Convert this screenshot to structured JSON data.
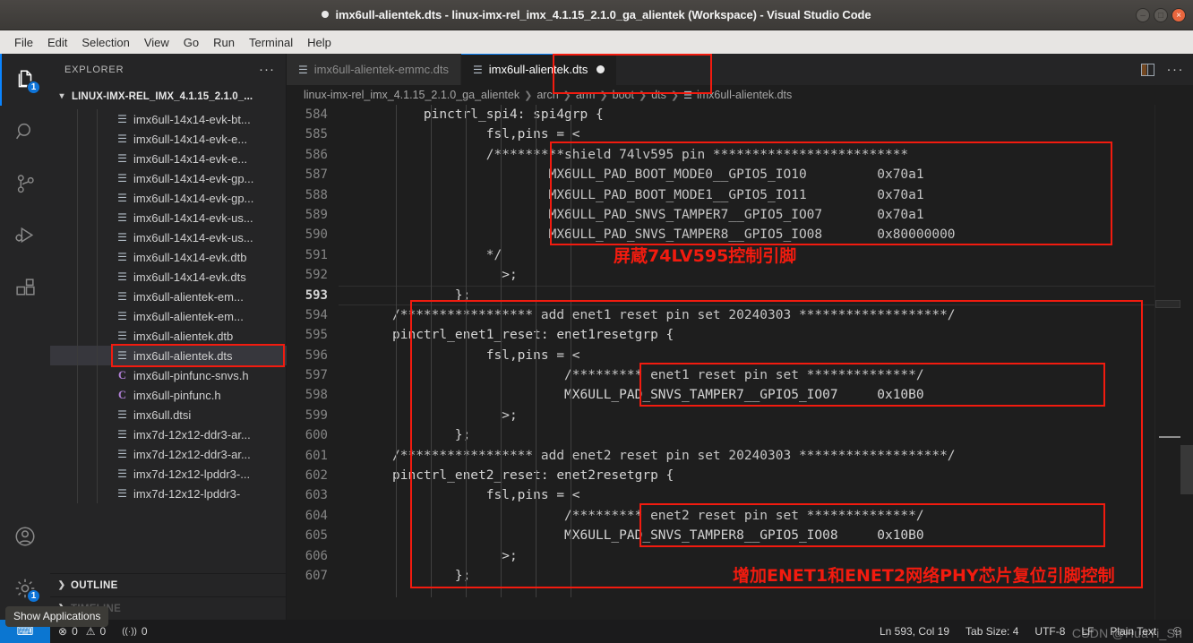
{
  "window": {
    "title": "imx6ull-alientek.dts - linux-imx-rel_imx_4.1.15_2.1.0_ga_alientek (Workspace) - Visual Studio Code",
    "dirty": true,
    "buttons": {
      "minimize": "–",
      "maximize": "□",
      "close": "×"
    }
  },
  "menubar": {
    "items": [
      "File",
      "Edit",
      "Selection",
      "View",
      "Go",
      "Run",
      "Terminal",
      "Help"
    ]
  },
  "activitybar": {
    "items": [
      {
        "name": "explorer-icon",
        "badge": "1",
        "active": true
      },
      {
        "name": "search-icon",
        "badge": "",
        "active": false
      },
      {
        "name": "source-control-icon",
        "badge": "",
        "active": false
      },
      {
        "name": "run-and-debug-icon",
        "badge": "",
        "active": false
      },
      {
        "name": "extensions-icon",
        "badge": "",
        "active": false
      }
    ],
    "bottom": [
      {
        "name": "accounts-icon",
        "badge": ""
      },
      {
        "name": "manage-gear-icon",
        "badge": "1"
      }
    ]
  },
  "sidebar": {
    "title": "EXPLORER",
    "more_actions": "···",
    "root_label": "LINUX-IMX-REL_IMX_4.1.15_2.1.0_...",
    "files": [
      {
        "label": "imx6ull-14x14-evk-bt...",
        "kind": "dts",
        "selected": false
      },
      {
        "label": "imx6ull-14x14-evk-e...",
        "kind": "dts",
        "selected": false
      },
      {
        "label": "imx6ull-14x14-evk-e...",
        "kind": "dts",
        "selected": false
      },
      {
        "label": "imx6ull-14x14-evk-gp...",
        "kind": "dts",
        "selected": false
      },
      {
        "label": "imx6ull-14x14-evk-gp...",
        "kind": "dts",
        "selected": false
      },
      {
        "label": "imx6ull-14x14-evk-us...",
        "kind": "dts",
        "selected": false
      },
      {
        "label": "imx6ull-14x14-evk-us...",
        "kind": "dts",
        "selected": false
      },
      {
        "label": "imx6ull-14x14-evk.dtb",
        "kind": "dts",
        "selected": false
      },
      {
        "label": "imx6ull-14x14-evk.dts",
        "kind": "dts",
        "selected": false
      },
      {
        "label": "imx6ull-alientek-em...",
        "kind": "dts",
        "selected": false
      },
      {
        "label": "imx6ull-alientek-em...",
        "kind": "dts",
        "selected": false
      },
      {
        "label": "imx6ull-alientek.dtb",
        "kind": "dts",
        "selected": false
      },
      {
        "label": "imx6ull-alientek.dts",
        "kind": "dts",
        "selected": true
      },
      {
        "label": "imx6ull-pinfunc-snvs.h",
        "kind": "c",
        "selected": false
      },
      {
        "label": "imx6ull-pinfunc.h",
        "kind": "c",
        "selected": false
      },
      {
        "label": "imx6ull.dtsi",
        "kind": "dts",
        "selected": false
      },
      {
        "label": "imx7d-12x12-ddr3-ar...",
        "kind": "dts",
        "selected": false
      },
      {
        "label": "imx7d-12x12-ddr3-ar...",
        "kind": "dts",
        "selected": false
      },
      {
        "label": "imx7d-12x12-lpddr3-...",
        "kind": "dts",
        "selected": false
      },
      {
        "label": "imx7d-12x12-lpddr3-",
        "kind": "dts",
        "selected": false
      }
    ],
    "sections": [
      {
        "label": "OUTLINE",
        "dim": false
      },
      {
        "label": "TIMELINE",
        "dim": true
      }
    ]
  },
  "tooltip": {
    "show_applications": "Show Applications"
  },
  "tabs": [
    {
      "label": "imx6ull-alientek-emmc.dts",
      "active": false,
      "dirty": false,
      "highlighted": false
    },
    {
      "label": "imx6ull-alientek.dts",
      "active": true,
      "dirty": true,
      "highlighted": true
    }
  ],
  "tabbar_actions": {
    "split_editor": "split-editor-icon",
    "more": "···"
  },
  "breadcrumb": {
    "parts": [
      "linux-imx-rel_imx_4.1.15_2.1.0_ga_alientek",
      "arch",
      "arm",
      "boot",
      "dts"
    ],
    "file": "imx6ull-alientek.dts",
    "separator": "❯"
  },
  "editor": {
    "first_line": 584,
    "current_line": 593,
    "lines": [
      {
        "n": 584,
        "text": "    pinctrl_spi4: spi4grp {"
      },
      {
        "n": 585,
        "text": "            fsl,pins = <"
      },
      {
        "n": 586,
        "text": "            /*********shield 74lv595 pin *************************",
        "comment": true
      },
      {
        "n": 587,
        "text": "                    MX6ULL_PAD_BOOT_MODE0__GPIO5_IO10         0x70a1",
        "comment": true
      },
      {
        "n": 588,
        "text": "                    MX6ULL_PAD_BOOT_MODE1__GPIO5_IO11         0x70a1",
        "comment": true
      },
      {
        "n": 589,
        "text": "                    MX6ULL_PAD_SNVS_TAMPER7__GPIO5_IO07       0x70a1",
        "comment": true
      },
      {
        "n": 590,
        "text": "                    MX6ULL_PAD_SNVS_TAMPER8__GPIO5_IO08       0x80000000",
        "comment": true
      },
      {
        "n": 591,
        "text": "            */",
        "comment": true
      },
      {
        "n": 592,
        "text": "              >;"
      },
      {
        "n": 593,
        "text": "        };"
      },
      {
        "n": 594,
        "text": "/***************** add enet1 reset pin set 20240303 *******************/",
        "comment": true
      },
      {
        "n": 595,
        "text": "pinctrl_enet1_reset: enet1resetgrp {"
      },
      {
        "n": 596,
        "text": "            fsl,pins = <"
      },
      {
        "n": 597,
        "text": "                      /********* enet1 reset pin set **************/",
        "comment": true
      },
      {
        "n": 598,
        "text": "                      MX6ULL_PAD_SNVS_TAMPER7__GPIO5_IO07     0x10B0"
      },
      {
        "n": 599,
        "text": "              >;"
      },
      {
        "n": 600,
        "text": "        };"
      },
      {
        "n": 601,
        "text": "/***************** add enet2 reset pin set 20240303 *******************/",
        "comment": true
      },
      {
        "n": 602,
        "text": "pinctrl_enet2_reset: enet2resetgrp {"
      },
      {
        "n": 603,
        "text": "            fsl,pins = <"
      },
      {
        "n": 604,
        "text": "                      /********* enet2 reset pin set **************/",
        "comment": true
      },
      {
        "n": 605,
        "text": "                      MX6ULL_PAD_SNVS_TAMPER8__GPIO5_IO08     0x10B0"
      },
      {
        "n": 606,
        "text": "              >;"
      },
      {
        "n": 607,
        "text": "        };"
      }
    ],
    "annotations": [
      {
        "name": "annotation-shield-74lv595",
        "text": "屏蔵74LV595控制引脚"
      },
      {
        "name": "annotation-enet-reset",
        "text": "增加ENET1和ENET2网络PHY芯片复位引脚控制"
      }
    ],
    "annotation_color": "#f21b0f"
  },
  "statusbar": {
    "remote_glyph": "⌨",
    "errors_icon": "⊗",
    "errors": "0",
    "warnings_icon": "⚠",
    "warnings": "0",
    "radio_icon": "((·))",
    "radio_count": "0",
    "cursor_position": "Ln 593, Col 19",
    "tab_size": "Tab Size: 4",
    "encoding": "UTF-8",
    "eol": "LF",
    "language": "Plain Text",
    "bell_icon": "⚇"
  },
  "watermark": {
    "text": "CSDN @HuaYi_Sh"
  }
}
